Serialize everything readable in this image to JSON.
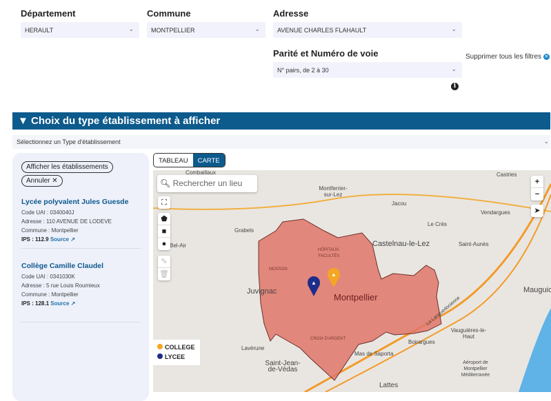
{
  "filters": {
    "departement": {
      "label": "Département",
      "value": "HERAULT"
    },
    "commune": {
      "label": "Commune",
      "value": "MONTPELLIER"
    },
    "adresse": {
      "label": "Adresse",
      "value": "AVENUE CHARLES FLAHAULT"
    },
    "parite": {
      "label": "Parité et Numéro de voie",
      "value": "N° pairs, de 2 à 30"
    },
    "clear_all": "Supprimer tous les filtres"
  },
  "section": {
    "title": "Choix du type établissement à afficher",
    "type_select_placeholder": "Sélectionnez un Type d'établissement"
  },
  "panel": {
    "show_button": "Afficher les établissements",
    "cancel_button": "Annuler",
    "establishments": [
      {
        "name": "Lycée polyvalent Jules Guesde",
        "code": "Code UAI : 0340040J",
        "adresse": "Adresse : 110 AVENUE DE LODEVE",
        "commune": "Commune : Montpellier",
        "ips": "IPS : 112.9",
        "source": "Source"
      },
      {
        "name": "Collège Camille Claudel",
        "code": "Code UAI : 0341030K",
        "adresse": "Adresse : 5 rue Louis Roumieux",
        "commune": "Commune : Montpellier",
        "ips": "IPS : 128.1",
        "source": "Source"
      }
    ]
  },
  "view_tabs": {
    "tableau": "TABLEAU",
    "carte": "CARTE",
    "active": "CARTE"
  },
  "map": {
    "search_placeholder": "Rechercher un lieu",
    "labels": [
      "Combaillaux",
      "Montferrier-sur-Lez",
      "Jacou",
      "Castries",
      "Vendargues",
      "Le Crès",
      "Grabels",
      "Bel-Air",
      "Castelnau-le-Lez",
      "Saint-Aunès",
      "Juvignac",
      "Montpellier",
      "Mauguio",
      "Lavérune",
      "Saint-Jean-de-Védas",
      "Mas de Saporta",
      "Boirargues",
      "Vauguières-le-Haut",
      "Aéroport de Montpellier Méditerranée",
      "Lattes",
      "HÔPITAUX-FACULTÉS",
      "MOSSON",
      "CROIX D'ARGENT",
      "La Languedocienne"
    ],
    "legend": [
      {
        "label": "COLLEGE",
        "color": "#f5a623"
      },
      {
        "label": "LYCEE",
        "color": "#1f2d8a"
      }
    ],
    "area_color": "#e0756a"
  }
}
